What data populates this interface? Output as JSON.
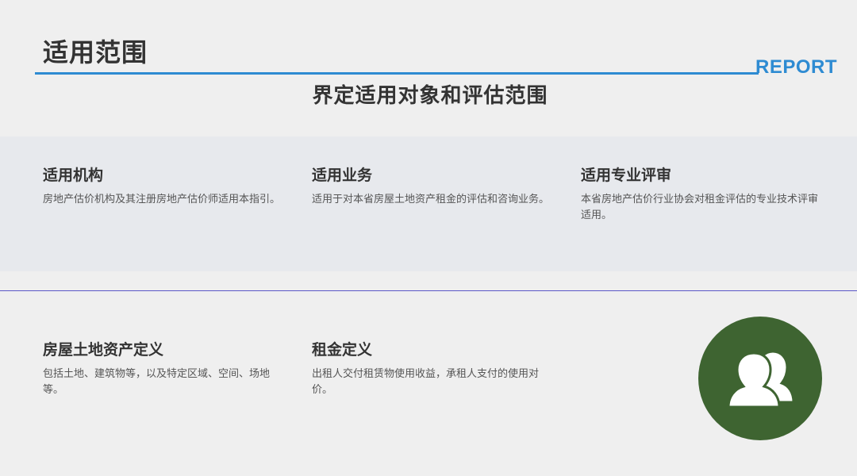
{
  "header": {
    "title": "适用范围",
    "brand": "REPORT"
  },
  "subtitle": "界定适用对象和评估范围",
  "cards_top": [
    {
      "heading": "适用机构",
      "text": "房地产估价机构及其注册房地产估价师适用本指引。"
    },
    {
      "heading": "适用业务",
      "text": "适用于对本省房屋土地资产租金的评估和咨询业务。"
    },
    {
      "heading": "适用专业评审",
      "text": "本省房地产估价行业协会对租金评估的专业技术评审适用。"
    }
  ],
  "cards_bottom": [
    {
      "heading": "房屋土地资产定义",
      "text": "包括土地、建筑物等，以及特定区域、空间、场地等。"
    },
    {
      "heading": "租金定义",
      "text": "出租人交付租赁物使用收益，承租人支付的使用对价。"
    }
  ],
  "icon": {
    "name": "users-icon",
    "background": "#3e6431",
    "color": "#ffffff"
  },
  "colors": {
    "accent": "#2e8bd2",
    "divider": "#5a57c8",
    "band": "#e7e9ed",
    "background": "#efefef"
  }
}
